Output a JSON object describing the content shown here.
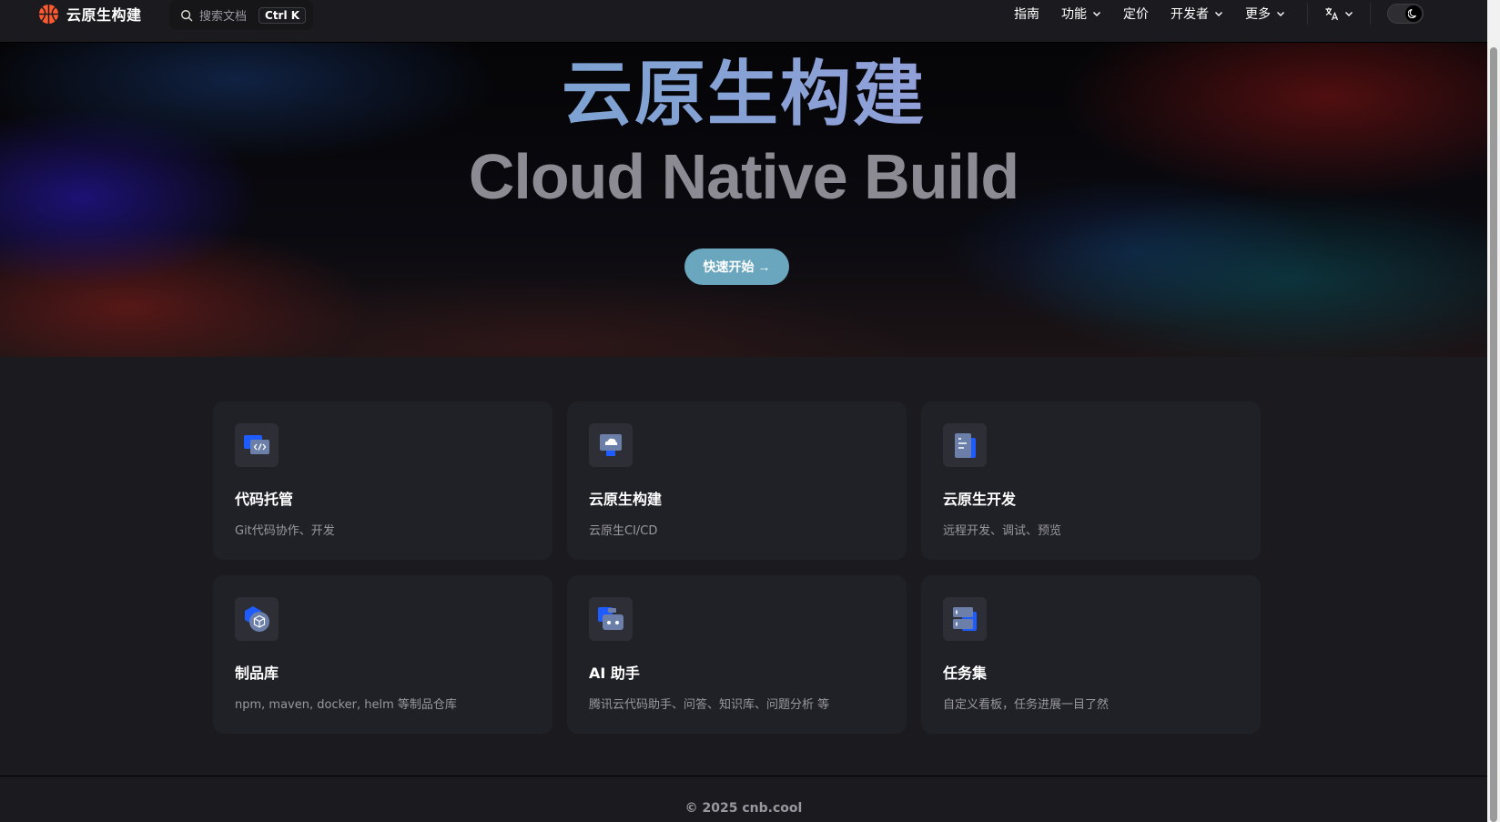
{
  "nav": {
    "brand": "云原生构建",
    "search_placeholder": "搜索文档",
    "search_shortcut": "Ctrl K",
    "links": [
      "指南",
      "功能",
      "定价",
      "开发者",
      "更多"
    ]
  },
  "hero": {
    "title": "云原生构建",
    "subtitle": "Cloud Native Build",
    "cta": "快速开始 →"
  },
  "features": [
    {
      "title": "代码托管",
      "desc": "Git代码协作、开发",
      "icon": "code-window-icon"
    },
    {
      "title": "云原生构建",
      "desc": "云原生CI/CD",
      "icon": "cloud-monitor-icon"
    },
    {
      "title": "云原生开发",
      "desc": "远程开发、调试、预览",
      "icon": "document-icon"
    },
    {
      "title": "制品库",
      "desc": "npm, maven, docker, helm 等制品仓库",
      "icon": "package-box-icon"
    },
    {
      "title": "AI 助手",
      "desc": "腾讯云代码助手、问答、知识库、问题分析 等",
      "icon": "robot-icon"
    },
    {
      "title": "任务集",
      "desc": "自定义看板，任务进展一目了然",
      "icon": "server-list-icon"
    }
  ],
  "footer": {
    "text": "© 2025 cnb.cool"
  },
  "colors": {
    "accent": "#6aa7be",
    "background": "#1b1b1f",
    "card": "#202127",
    "brand_logo": "#ff5a2e"
  }
}
